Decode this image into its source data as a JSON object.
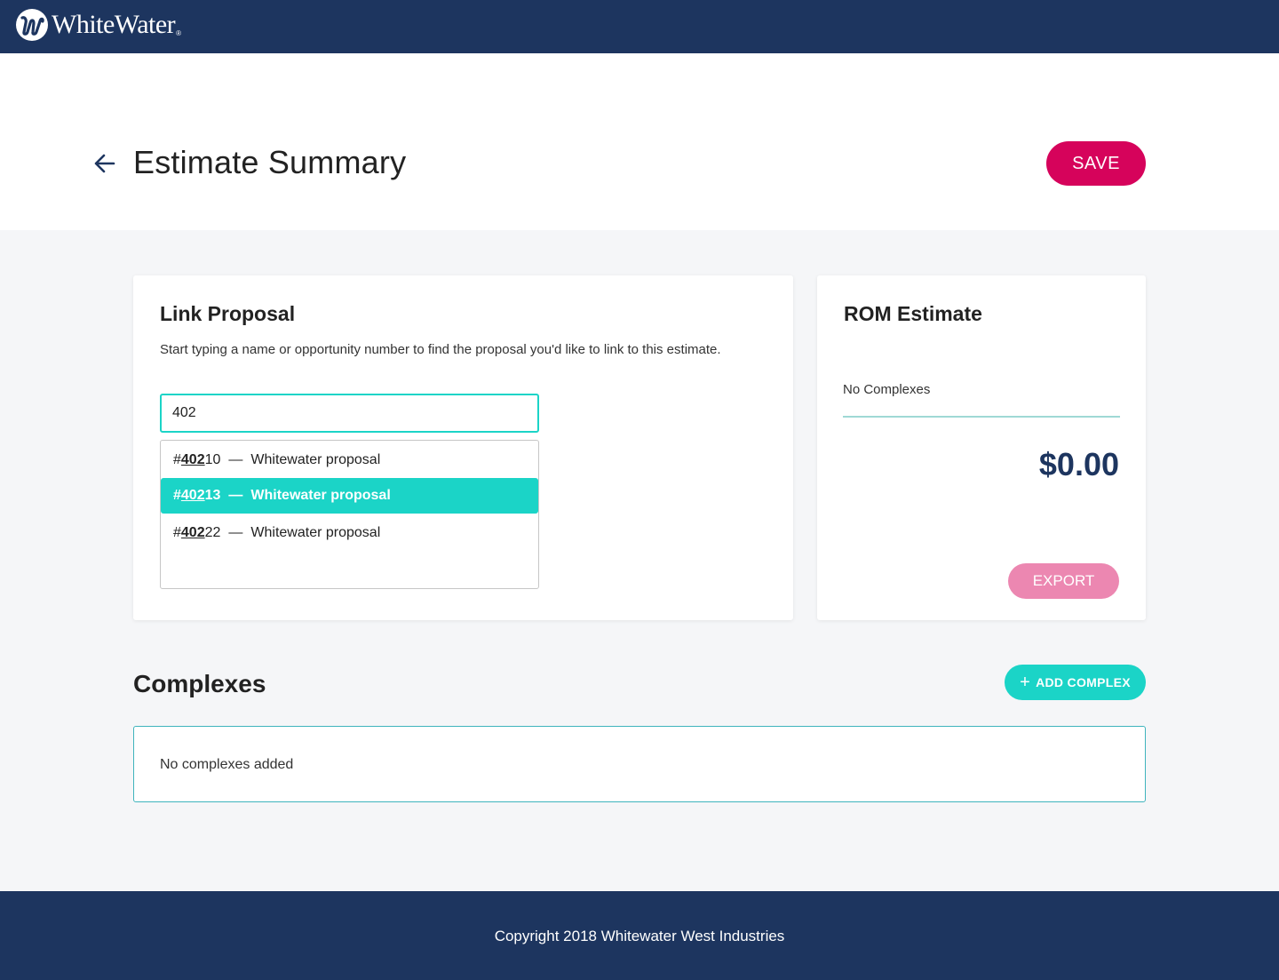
{
  "brand": {
    "name": "WhiteWater",
    "registered": "®"
  },
  "header": {
    "title": "Estimate Summary",
    "save_label": "SAVE",
    "back_icon": "arrow-left-icon"
  },
  "link_proposal": {
    "title": "Link Proposal",
    "description": "Start typing a name or opportunity number to find the proposal you'd like to link to this estimate.",
    "search_value": "402",
    "results": [
      {
        "prefix": "#",
        "match": "402",
        "rest": "10",
        "dash": "—",
        "name": "Whitewater proposal",
        "active": false
      },
      {
        "prefix": "#",
        "match": "402",
        "rest": "13",
        "dash": "—",
        "name": "Whitewater proposal",
        "active": true
      },
      {
        "prefix": "#",
        "match": "402",
        "rest": "22",
        "dash": "—",
        "name": "Whitewater proposal",
        "active": false
      }
    ]
  },
  "rom_estimate": {
    "title": "ROM Estimate",
    "complexes_label": "No Complexes",
    "total": "$0.00",
    "export_label": "EXPORT"
  },
  "complexes": {
    "title": "Complexes",
    "add_label": "ADD COMPLEX",
    "add_icon": "plus-icon",
    "empty_text": "No complexes added"
  },
  "footer": {
    "copyright": "Copyright 2018 Whitewater West Industries"
  },
  "colors": {
    "navy": "#1d355f",
    "teal": "#1bd4c7",
    "magenta": "#d6035b",
    "pink": "#ec87b1"
  }
}
